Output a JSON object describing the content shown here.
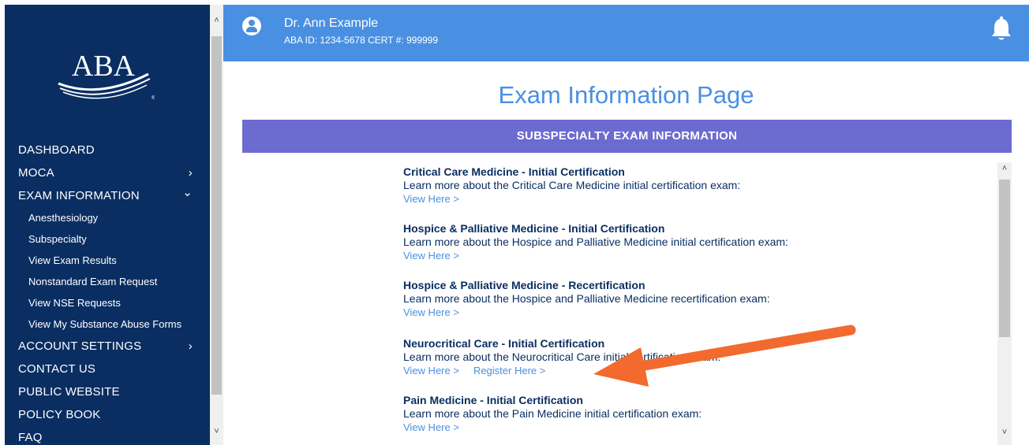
{
  "user": {
    "name": "Dr. Ann Example",
    "meta": "ABA ID: 1234-5678 CERT #: 999999"
  },
  "logo": {
    "text": "ABA"
  },
  "sidebar": {
    "items": [
      {
        "label": "DASHBOARD"
      },
      {
        "label": "MOCA",
        "chevron": "›"
      },
      {
        "label": "EXAM INFORMATION",
        "chevron": "⌄"
      },
      {
        "label": "ACCOUNT SETTINGS",
        "chevron": "›"
      },
      {
        "label": "CONTACT US"
      },
      {
        "label": "PUBLIC WEBSITE"
      },
      {
        "label": "POLICY BOOK"
      },
      {
        "label": "FAQ"
      }
    ],
    "sub_items": [
      {
        "label": "Anesthesiology"
      },
      {
        "label": "Subspecialty"
      },
      {
        "label": "View Exam Results"
      },
      {
        "label": "Nonstandard Exam Request"
      },
      {
        "label": "View NSE Requests"
      },
      {
        "label": "View My Substance Abuse Forms"
      }
    ]
  },
  "main": {
    "title": "Exam Information Page",
    "banner": "SUBSPECIALTY EXAM INFORMATION",
    "exams": [
      {
        "title": "Critical Care Medicine - Initial Certification",
        "desc": "Learn more about the Critical Care Medicine initial certification exam:",
        "view": "View Here >"
      },
      {
        "title": "Hospice & Palliative Medicine - Initial Certification",
        "desc": "Learn more about the Hospice and Palliative Medicine initial certification exam:",
        "view": "View Here >"
      },
      {
        "title": "Hospice & Palliative Medicine - Recertification",
        "desc": "Learn more about the Hospice and Palliative Medicine recertification exam:",
        "view": "View Here >"
      },
      {
        "title": "Neurocritical Care - Initial Certification",
        "desc": "Learn more about the Neurocritical Care initial certification exam:",
        "view": "View Here >",
        "register": "Register Here >"
      },
      {
        "title": "Pain Medicine - Initial Certification",
        "desc": "Learn more about the Pain Medicine initial certification exam:",
        "view": "View Here >"
      }
    ]
  },
  "colors": {
    "sidebar": "#0a2e62",
    "header": "#4a90e2",
    "banner": "#6c6bd0",
    "annotation_arrow": "#f26a2e"
  },
  "icons": [
    "user-avatar-icon",
    "bell-icon",
    "chevron-right-icon",
    "chevron-down-icon",
    "scroll-up-icon",
    "scroll-down-icon"
  ]
}
